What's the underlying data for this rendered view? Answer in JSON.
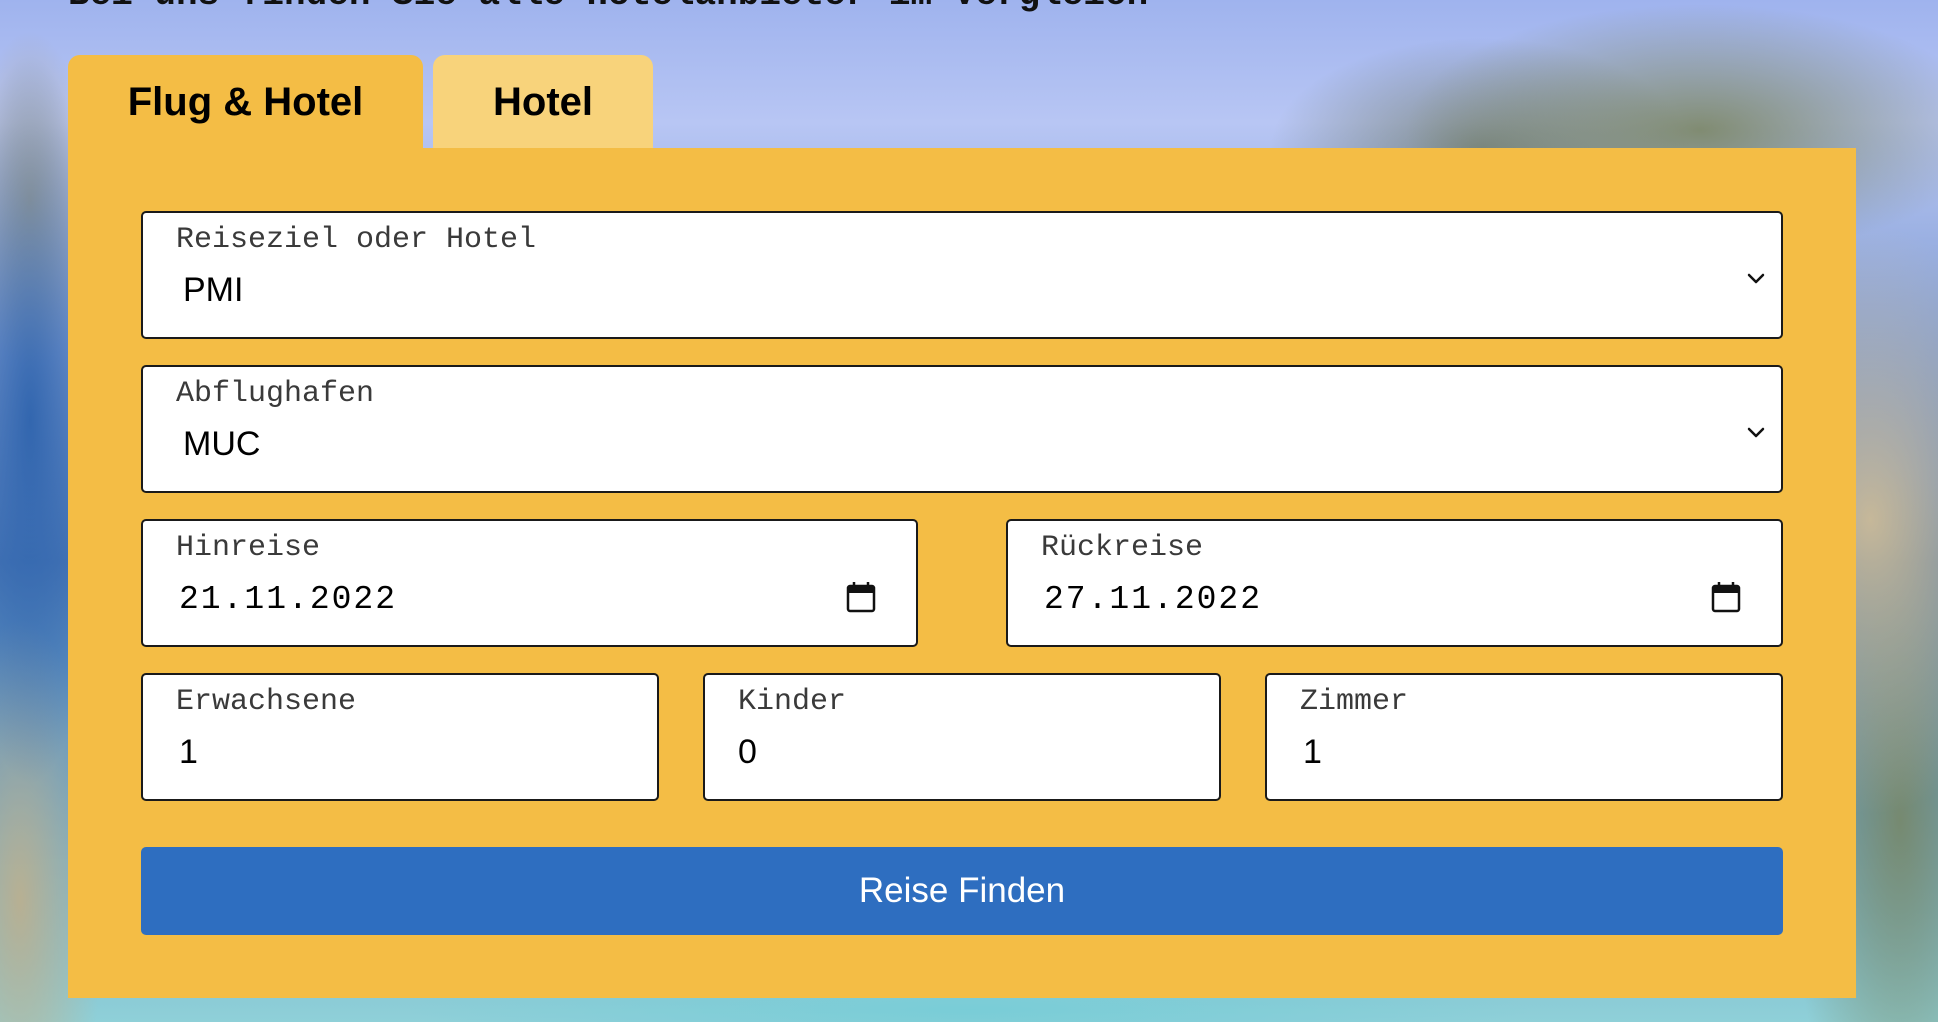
{
  "header": {
    "headline": "Bei uns finden Sie alle Hotelanbieter im Vergleich"
  },
  "tabs": [
    {
      "label": "Flug & Hotel",
      "active": true
    },
    {
      "label": "Hotel",
      "active": false
    }
  ],
  "form": {
    "destination": {
      "label": "Reiseziel oder Hotel",
      "value": "PMI"
    },
    "departure_airport": {
      "label": "Abflughafen",
      "value": "MUC"
    },
    "outbound": {
      "label": "Hinreise",
      "value": "21.11.2022"
    },
    "return": {
      "label": "Rückreise",
      "value": "27.11.2022"
    },
    "adults": {
      "label": "Erwachsene",
      "value": "1"
    },
    "children": {
      "label": "Kinder",
      "value": "0"
    },
    "rooms": {
      "label": "Zimmer",
      "value": "1"
    },
    "submit_label": "Reise Finden"
  },
  "colors": {
    "panel": "#f4bd45",
    "inactive_tab": "#f8d37b",
    "button": "#2e6ec0"
  },
  "icons": {
    "select_indicator": "chevron-down-icon",
    "date_picker": "calendar-icon"
  }
}
